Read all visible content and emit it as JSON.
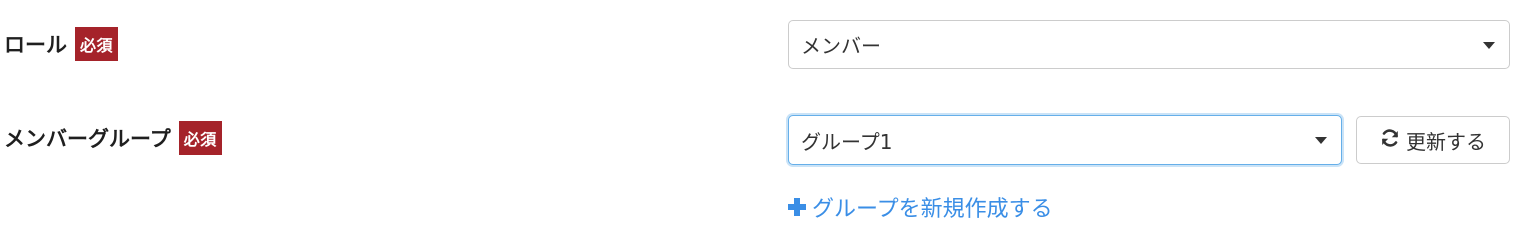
{
  "form": {
    "role": {
      "label": "ロール",
      "required_badge": "必須",
      "selected_value": "メンバー"
    },
    "member_group": {
      "label": "メンバーグループ",
      "required_badge": "必須",
      "selected_value": "グループ1",
      "refresh_label": "更新する",
      "create_link_label": "グループを新規作成する"
    }
  },
  "icons": {
    "refresh": "refresh-icon",
    "plus": "plus-icon",
    "caret": "chevron-down-icon"
  },
  "colors": {
    "required_badge": "#a5232a",
    "link": "#3a8ee6",
    "focus_border": "#66afe9"
  }
}
